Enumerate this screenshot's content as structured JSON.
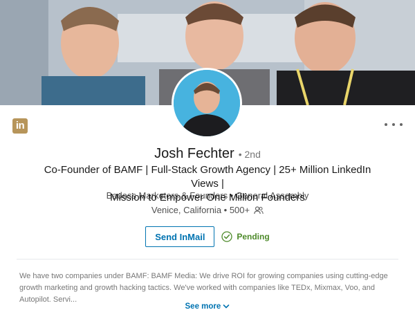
{
  "cover": {
    "icon": "cover-photo"
  },
  "avatar": {
    "icon": "profile-photo"
  },
  "brand": {
    "logo_text": "in",
    "color": "#b7955a"
  },
  "profile": {
    "name": "Josh Fechter",
    "degree": "• 2nd",
    "headline_line1": "Co-Founder of BAMF | Full-Stack Growth Agency | 25+ Million LinkedIn Views |",
    "headline_line2": "Mission to Empower One Million Founders",
    "company": "Badass Marketers & Founders • General Assembly",
    "location": "Venice, California • 500+"
  },
  "actions": {
    "inmail_label": "Send InMail",
    "pending_label": "Pending",
    "accent": "#0073b1",
    "pending_color": "#4d8a2a"
  },
  "summary": {
    "text": "We have two companies under BAMF: BAMF Media: We drive ROI for growing companies using cutting-edge growth marketing and growth hacking tactics. We've worked with companies like TEDx, Mixmax, Voo, and Autopilot. Servi...",
    "see_more_label": "See more"
  }
}
